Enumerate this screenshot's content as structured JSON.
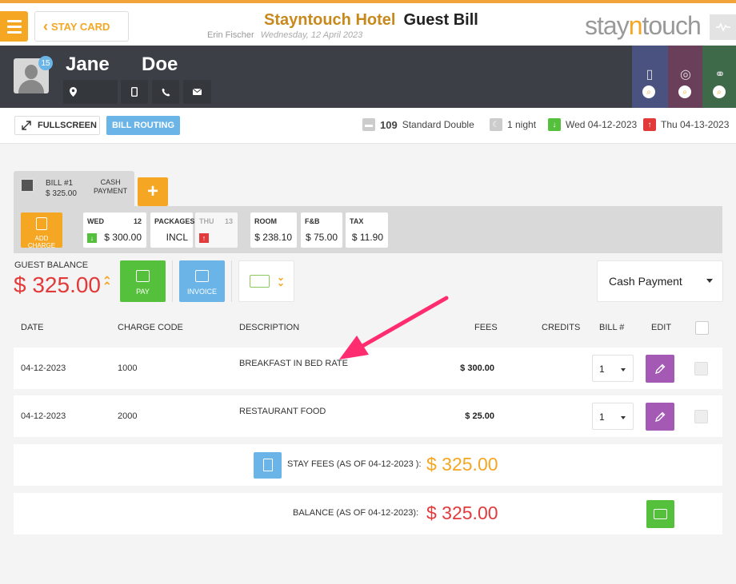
{
  "header": {
    "stay_card_label": "STAY CARD",
    "hotel_name": "Stayntouch Hotel",
    "page_title": "Guest Bill",
    "user": "Erin Fischer",
    "date": "Wednesday, 12 April 2023",
    "brand_prefix": "stay",
    "brand_accent": "n",
    "brand_suffix": "touch"
  },
  "guest": {
    "first_name": "Jane",
    "last_name": "Doe",
    "badge_count": "15"
  },
  "toolbar": {
    "fullscreen_label": "FULLSCREEN",
    "bill_routing_label": "BILL ROUTING",
    "room_number": "109",
    "room_type": "Standard Double",
    "nights": "1 night",
    "arrival": "Wed 04-12-2023",
    "departure": "Thu 04-13-2023"
  },
  "bill_tab": {
    "title": "BILL #1",
    "amount": "$ 325.00",
    "payment_line1": "CASH",
    "payment_line2": "PAYMENT"
  },
  "summary": {
    "add_charge_line1": "ADD",
    "add_charge_line2": "CHARGE",
    "cells": [
      {
        "label": "WED",
        "num": "12",
        "value": "$ 300.00"
      },
      {
        "label": "PACKAGES",
        "num": "",
        "value": "INCL"
      },
      {
        "label": "THU",
        "num": "13",
        "value": ""
      },
      {
        "label": "ROOM",
        "num": "",
        "value": "$ 238.10"
      },
      {
        "label": "F&B",
        "num": "",
        "value": "$ 75.00"
      },
      {
        "label": "TAX",
        "num": "",
        "value": "$ 11.90"
      }
    ]
  },
  "balance": {
    "label": "GUEST BALANCE",
    "amount": "$ 325.00",
    "pay_label": "PAY",
    "invoice_label": "INVOICE",
    "payment_method": "Cash Payment"
  },
  "table": {
    "headers": {
      "date": "DATE",
      "charge_code": "CHARGE CODE",
      "description": "DESCRIPTION",
      "fees": "FEES",
      "credits": "CREDITS",
      "bill": "BILL #",
      "edit": "EDIT"
    },
    "rows": [
      {
        "date": "04-12-2023",
        "code": "1000",
        "description": "BREAKFAST IN BED RATE",
        "fees": "$ 300.00",
        "bill": "1"
      },
      {
        "date": "04-12-2023",
        "code": "2000",
        "description": "RESTAURANT FOOD",
        "fees": "$ 25.00",
        "bill": "1"
      }
    ]
  },
  "totals": {
    "stay_fees_label": "STAY FEES (AS OF  04-12-2023 ):",
    "stay_fees_amount": "$ 325.00",
    "balance_label": "BALANCE (AS OF  04-12-2023):",
    "balance_amount": "$ 325.00"
  },
  "colors": {
    "accent": "#f5a623",
    "danger": "#e23a3a",
    "pay_green": "#55c03b",
    "info_blue": "#6ab4e8",
    "edit_purple": "#a45ab5",
    "annotation_pink": "#ff2d6f"
  }
}
